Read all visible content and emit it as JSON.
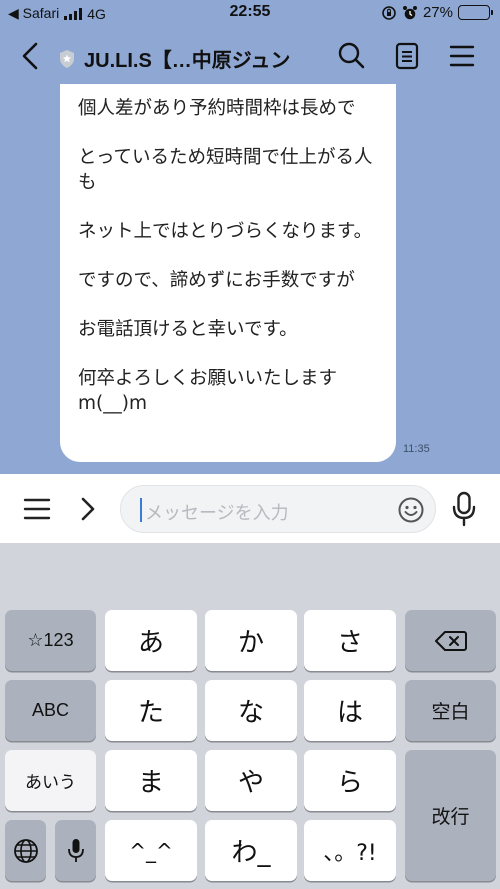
{
  "status_bar": {
    "back_app": "◀ Safari",
    "network": "4G",
    "time": "22:55",
    "battery_text": "27%",
    "battery_level": 0.27
  },
  "header": {
    "title": "JU.LI.S【…中原ジュン"
  },
  "message": {
    "lines": [
      "個人差があり予約時間枠は長めで",
      "とっているため短時間で仕上がる人も",
      "ネット上ではとりづらくなります。",
      "ですので、諦めずにお手数ですが",
      "お電話頂けると幸いです。",
      "何卒よろしくお願いいたします\nm(__)m"
    ],
    "time": "11:35"
  },
  "input": {
    "placeholder": "メッセージを入力"
  },
  "keyboard": {
    "keys": {
      "num": "☆123",
      "a": "あ",
      "ka": "か",
      "sa": "さ",
      "abc": "ABC",
      "ta": "た",
      "na": "な",
      "ha": "は",
      "space": "空白",
      "aiu": "あいう",
      "ma": "ま",
      "ya": "や",
      "ra": "ら",
      "enter": "改行",
      "face": "^_^",
      "wa": "わ_",
      "punct": "、。?!"
    }
  },
  "colors": {
    "chat_bg": "#8ea7d3",
    "bubble_bg": "#ffffff",
    "keyboard_bg": "#d1d4da",
    "key_dark": "#abb1bd",
    "caret": "#3a7bd5"
  }
}
